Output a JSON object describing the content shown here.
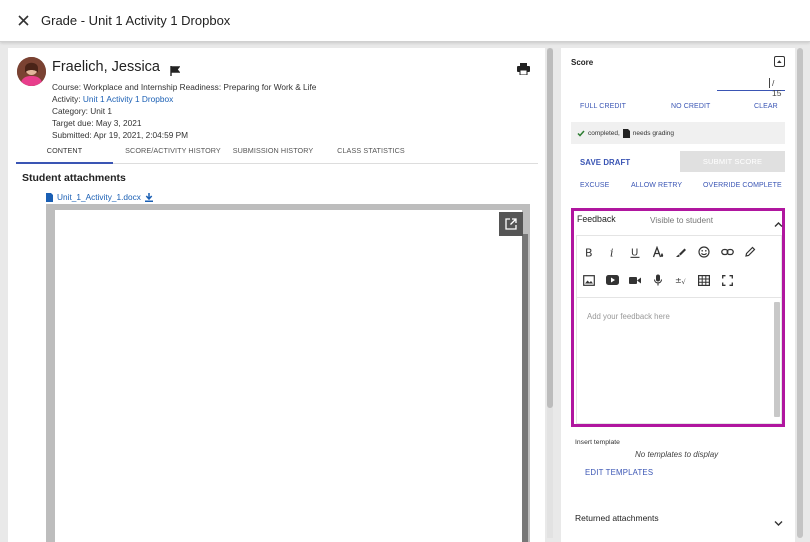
{
  "window": {
    "title": "Grade - Unit 1 Activity 1 Dropbox"
  },
  "student": {
    "name": "Fraelich, Jessica",
    "course_label": "Course:",
    "course": "Workplace and Internship Readiness: Preparing for Work & Life",
    "activity_label": "Activity:",
    "activity": "Unit 1 Activity 1 Dropbox",
    "category": "Category: Unit 1",
    "target_due": "Target due: May 3, 2021",
    "submitted": "Submitted: Apr 19, 2021, 2:04:59 PM"
  },
  "tabs": [
    {
      "label": "CONTENT",
      "active": true
    },
    {
      "label": "SCORE/ACTIVITY HISTORY",
      "active": false
    },
    {
      "label": "SUBMISSION HISTORY",
      "active": false
    },
    {
      "label": "CLASS STATISTICS",
      "active": false
    }
  ],
  "attachments": {
    "heading": "Student attachments",
    "file_name": "Unit_1_Activity_1.docx"
  },
  "score": {
    "label": "Score",
    "max": "/ 15",
    "full_credit": "FULL CREDIT",
    "no_credit": "NO CREDIT",
    "clear": "CLEAR",
    "status_completed": "completed,",
    "status_needs_grading": "needs grading",
    "save_draft": "SAVE DRAFT",
    "submit_score": "SUBMIT SCORE",
    "excuse": "EXCUSE",
    "allow_retry": "ALLOW RETRY",
    "override_complete": "OVERRIDE COMPLETE"
  },
  "feedback": {
    "title": "Feedback",
    "visibility": "Visible to student",
    "placeholder": "Add your feedback here"
  },
  "templates": {
    "label": "Insert template",
    "empty": "No templates to display",
    "edit": "EDIT TEMPLATES"
  },
  "returned_attachments": {
    "label": "Returned attachments"
  },
  "colors": {
    "accent": "#3a55b4",
    "highlight": "#b0169f",
    "link": "#1a5fb4"
  }
}
